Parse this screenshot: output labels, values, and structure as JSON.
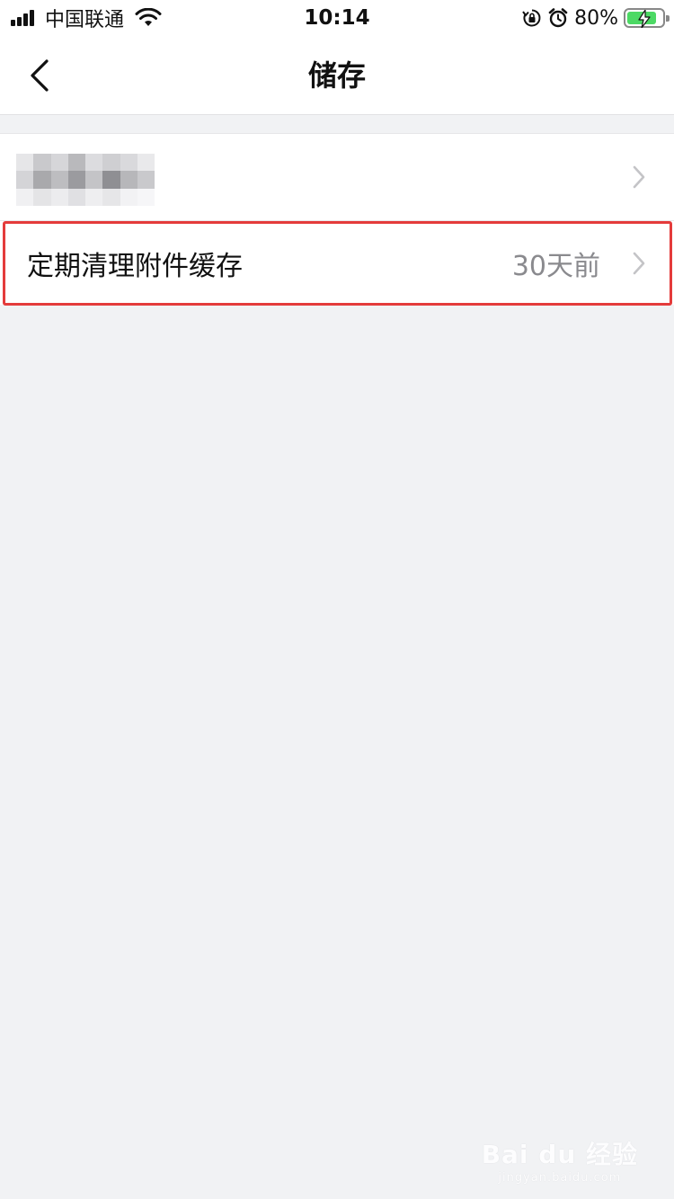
{
  "status_bar": {
    "carrier": "中国联通",
    "time": "10:14",
    "battery_percent": "80%",
    "battery_level": 0.8,
    "battery_color": "#4cd964",
    "icons": [
      "signal-icon",
      "wifi-icon",
      "orientation-lock-icon",
      "alarm-icon",
      "battery-icon",
      "charging-icon"
    ]
  },
  "nav": {
    "title": "储存",
    "back_icon": "chevron-left-icon"
  },
  "list": {
    "rows": [
      {
        "label": "",
        "value": "",
        "redacted": true,
        "icon": "chevron-right-icon"
      },
      {
        "label": "定期清理附件缓存",
        "value": "30天前",
        "icon": "chevron-right-icon",
        "highlighted": true
      }
    ]
  },
  "highlight_color": "#e43b3b",
  "watermark": {
    "main": "Bai du 经验",
    "sub": "jingyan.baidu.com"
  }
}
